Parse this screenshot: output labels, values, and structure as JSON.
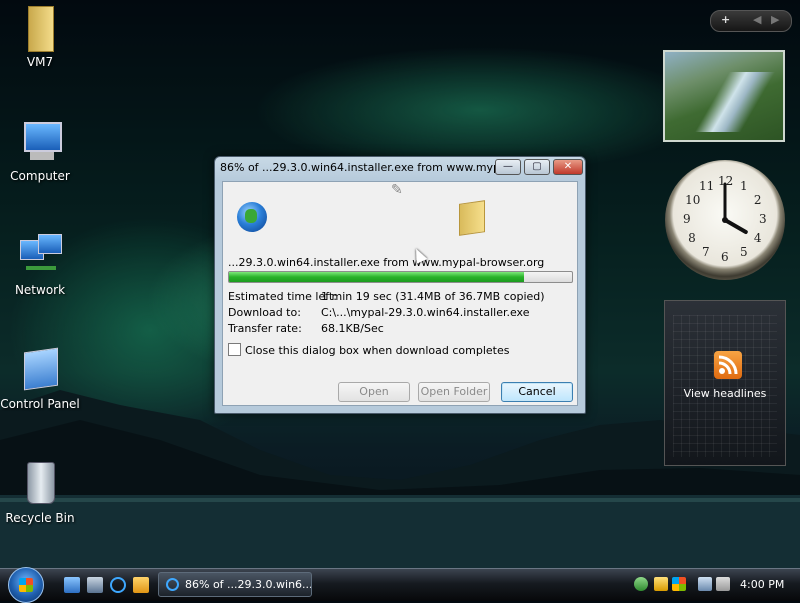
{
  "desktop": {
    "icons": [
      {
        "label": "VM7",
        "icon": "folder-icon"
      },
      {
        "label": "Computer",
        "icon": "computer-icon"
      },
      {
        "label": "Network",
        "icon": "network-icon"
      },
      {
        "label": "Control Panel",
        "icon": "control-panel-icon"
      },
      {
        "label": "Recycle Bin",
        "icon": "recycle-bin-icon"
      }
    ]
  },
  "gadgets": {
    "controls": {
      "add": "+",
      "prev": "◀",
      "next": "▶"
    },
    "clock_numbers": [
      "12",
      "1",
      "2",
      "3",
      "4",
      "5",
      "6",
      "7",
      "8",
      "9",
      "10",
      "11"
    ],
    "clock_time": {
      "hour": 4,
      "minute": 0
    },
    "rss_label": "View headlines"
  },
  "dialog": {
    "title": "86% of ...29.3.0.win64.installer.exe from www.myp...",
    "file_line": "...29.3.0.win64.installer.exe from www.mypal-browser.org",
    "progress_fraction": 0.86,
    "rows": [
      {
        "label": "Estimated time left:",
        "value": "1 min 19 sec (31.4MB of 36.7MB copied)"
      },
      {
        "label": "Download to:",
        "value": "C:\\...\\mypal-29.3.0.win64.installer.exe"
      },
      {
        "label": "Transfer rate:",
        "value": "68.1KB/Sec"
      }
    ],
    "checkbox_label": "Close this dialog box when download completes",
    "buttons": {
      "open": "Open",
      "open_folder": "Open Folder",
      "cancel": "Cancel"
    },
    "titlebar_buttons": {
      "minimize": "—",
      "maximize": "▢",
      "close": "✕"
    }
  },
  "taskbar": {
    "task_label": "86% of ...29.3.0.win6...",
    "clock": "4:00 PM"
  }
}
